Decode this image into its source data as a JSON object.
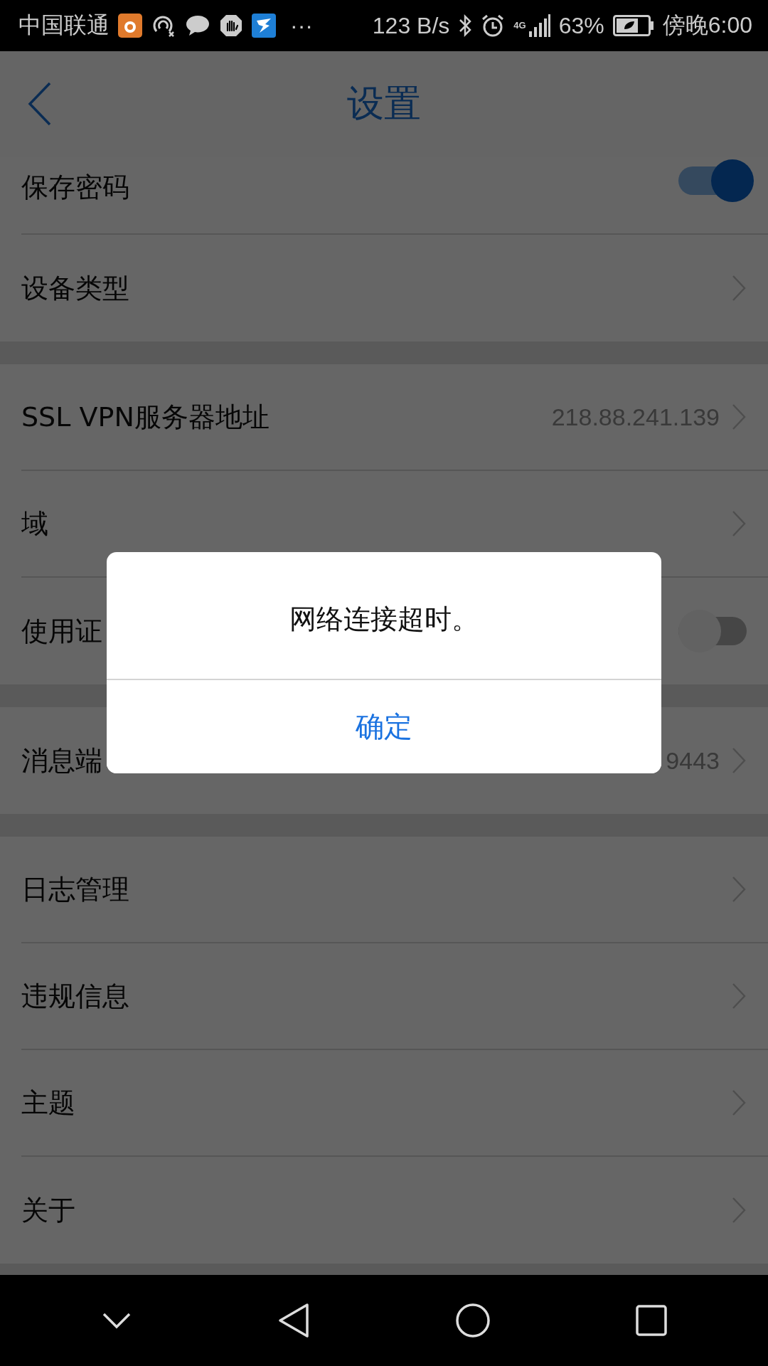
{
  "status_bar": {
    "carrier": "中国联通",
    "more": "···",
    "speed": "123 B/s",
    "network": "4G",
    "battery": "63%",
    "time": "傍晚6:00"
  },
  "header": {
    "title": "设置"
  },
  "sections": [
    {
      "rows": [
        {
          "kind": "toggle",
          "label": "保存密码",
          "on": true
        },
        {
          "kind": "link",
          "label": "设备类型"
        }
      ]
    },
    {
      "rows": [
        {
          "kind": "link",
          "label": "SSL VPN服务器地址",
          "value": "218.88.241.139"
        },
        {
          "kind": "link",
          "label": "域"
        },
        {
          "kind": "toggle",
          "label": "使用证",
          "on": false
        }
      ]
    },
    {
      "rows": [
        {
          "kind": "link",
          "label": "消息端",
          "value": "9443"
        }
      ]
    },
    {
      "rows": [
        {
          "kind": "link",
          "label": "日志管理"
        },
        {
          "kind": "link",
          "label": "违规信息"
        },
        {
          "kind": "link",
          "label": "主题"
        },
        {
          "kind": "link",
          "label": "关于"
        }
      ]
    }
  ],
  "dialog": {
    "message": "网络连接超时。",
    "button": "确定"
  }
}
